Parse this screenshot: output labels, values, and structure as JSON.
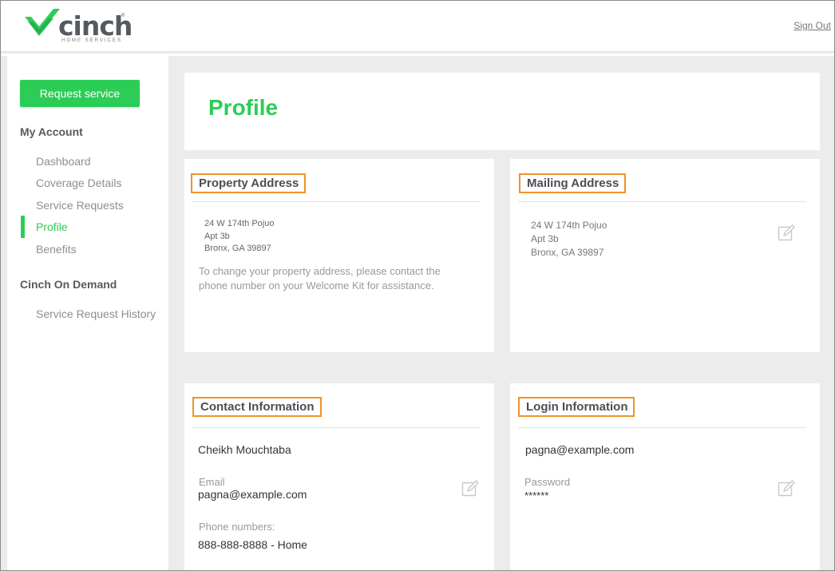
{
  "header": {
    "logo_word": "cinch",
    "logo_tm": "®",
    "logo_sub": "HOME SERVICES",
    "sign_out": "Sign Out"
  },
  "sidebar": {
    "request_button": "Request service",
    "my_account": "My Account",
    "items": [
      {
        "label": "Dashboard"
      },
      {
        "label": "Coverage Details"
      },
      {
        "label": "Service Requests"
      },
      {
        "label": "Profile"
      },
      {
        "label": "Benefits"
      }
    ],
    "on_demand": "Cinch On Demand",
    "history": "Service Request History"
  },
  "main": {
    "title": "Profile",
    "property": {
      "title": "Property Address",
      "line1": "24 W 174th Pojuo",
      "line2": "Apt 3b",
      "line3": "Bronx, GA 39897",
      "note_line1": "To change your property address, please contact the",
      "note_line2": "phone number on your Welcome Kit for assistance."
    },
    "mailing": {
      "title": "Mailing Address",
      "line1": "24 W 174th Pojuo",
      "line2": "Apt 3b",
      "line3": "Bronx, GA 39897"
    },
    "contact": {
      "title": "Contact Information",
      "name": "Cheikh Mouchtaba",
      "email_label": "Email",
      "email": "pagna@example.com",
      "phone_label": "Phone numbers:",
      "phone": "888-888-8888 - Home"
    },
    "login": {
      "title": "Login Information",
      "username": "pagna@example.com",
      "password_label": "Password",
      "password": "******"
    }
  },
  "colors": {
    "brand_green": "#2ccd57",
    "highlight_orange": "#f0922a",
    "panel_bg": "#ececec"
  },
  "icons": [
    "cinch-check-logo",
    "edit-icon"
  ]
}
